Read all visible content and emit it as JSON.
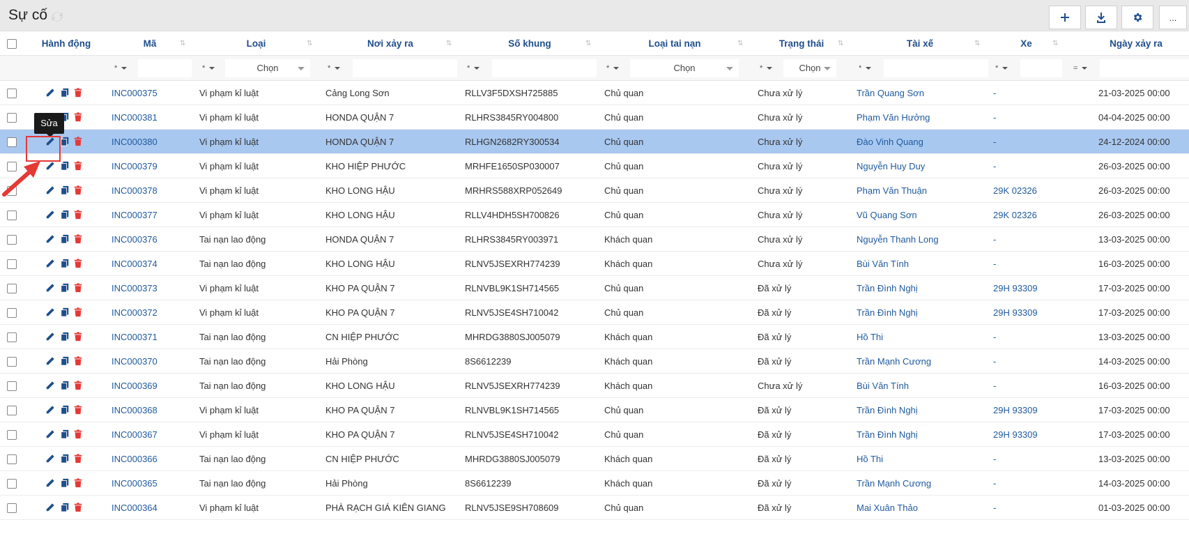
{
  "header": {
    "title": "Sự cố"
  },
  "toolbar": {
    "more_label": "..."
  },
  "columns": {
    "action": "Hành động",
    "code": "Mã",
    "type": "Loại",
    "place": "Nơi xảy ra",
    "chassis": "Số khung",
    "accident_type": "Loại tai nạn",
    "status": "Trạng thái",
    "driver": "Tài xế",
    "vehicle": "Xe",
    "date": "Ngày xảy ra"
  },
  "filters": {
    "op_star": "*",
    "op_eq": "=",
    "select_placeholder": "Chọn"
  },
  "tooltip": {
    "text": "Sửa"
  },
  "rows": [
    {
      "code": "INC000375",
      "type": "Vi phạm kỉ luật",
      "place": "Cảng Long Sơn",
      "chassis": "RLLV3F5DXSH725885",
      "accident_type": "Chủ quan",
      "status": "Chưa xử lý",
      "driver": "Trần Quang Sơn",
      "vehicle": "-",
      "date": "21-03-2025 00:00"
    },
    {
      "code": "INC000381",
      "type": "Vi phạm kỉ luật",
      "place": "HONDA QUẬN 7",
      "chassis": "RLHRS3845RY004800",
      "accident_type": "Chủ quan",
      "status": "Chưa xử lý",
      "driver": "Phạm Văn Hưởng",
      "vehicle": "-",
      "date": "04-04-2025 00:00"
    },
    {
      "code": "INC000380",
      "type": "Vi phạm kỉ luật",
      "place": "HONDA QUẬN 7",
      "chassis": "RLHGN2682RY300534",
      "accident_type": "Chủ quan",
      "status": "Chưa xử lý",
      "driver": "Đào Vinh Quang",
      "vehicle": "-",
      "date": "24-12-2024 00:00"
    },
    {
      "code": "INC000379",
      "type": "Vi phạm kỉ luật",
      "place": "KHO HIỆP PHƯỚC",
      "chassis": "MRHFE1650SP030007",
      "accident_type": "Chủ quan",
      "status": "Chưa xử lý",
      "driver": "Nguyễn Huy Duy",
      "vehicle": "-",
      "date": "26-03-2025 00:00"
    },
    {
      "code": "INC000378",
      "type": "Vi phạm kỉ luật",
      "place": "KHO LONG HẬU",
      "chassis": "MRHRS588XRP052649",
      "accident_type": "Chủ quan",
      "status": "Chưa xử lý",
      "driver": "Phạm Văn Thuận",
      "vehicle": "29K 02326",
      "date": "26-03-2025 00:00"
    },
    {
      "code": "INC000377",
      "type": "Vi phạm kỉ luật",
      "place": "KHO LONG HẬU",
      "chassis": "RLLV4HDH5SH700826",
      "accident_type": "Chủ quan",
      "status": "Chưa xử lý",
      "driver": "Vũ Quang Sơn",
      "vehicle": "29K 02326",
      "date": "26-03-2025 00:00"
    },
    {
      "code": "INC000376",
      "type": "Tai nạn lao động",
      "place": "HONDA QUẬN 7",
      "chassis": "RLHRS3845RY003971",
      "accident_type": "Khách quan",
      "status": "Chưa xử lý",
      "driver": "Nguyễn Thanh Long",
      "vehicle": "-",
      "date": "13-03-2025 00:00"
    },
    {
      "code": "INC000374",
      "type": "Tai nạn lao động",
      "place": "KHO LONG HẬU",
      "chassis": "RLNV5JSEXRH774239",
      "accident_type": "Khách quan",
      "status": "Chưa xử lý",
      "driver": "Bùi Văn Tính",
      "vehicle": "-",
      "date": "16-03-2025 00:00"
    },
    {
      "code": "INC000373",
      "type": "Vi phạm kỉ luật",
      "place": "KHO PA QUẬN 7",
      "chassis": "RLNVBL9K1SH714565",
      "accident_type": "Chủ quan",
      "status": "Đã xử lý",
      "driver": "Trần Đình Nghị",
      "vehicle": "29H 93309",
      "date": "17-03-2025 00:00"
    },
    {
      "code": "INC000372",
      "type": "Vi phạm kỉ luật",
      "place": "KHO PA QUẬN 7",
      "chassis": "RLNV5JSE4SH710042",
      "accident_type": "Chủ quan",
      "status": "Đã xử lý",
      "driver": "Trần Đình Nghị",
      "vehicle": "29H 93309",
      "date": "17-03-2025 00:00"
    },
    {
      "code": "INC000371",
      "type": "Tai nạn lao động",
      "place": "CN HIỆP PHƯỚC",
      "chassis": "MHRDG3880SJ005079",
      "accident_type": "Khách quan",
      "status": "Đã xử lý",
      "driver": "Hồ Thi",
      "vehicle": "-",
      "date": "13-03-2025 00:00"
    },
    {
      "code": "INC000370",
      "type": "Tai nạn lao động",
      "place": "Hải Phòng",
      "chassis": "8S6612239",
      "accident_type": "Khách quan",
      "status": "Đã xử lý",
      "driver": "Trần Mạnh Cương",
      "vehicle": "-",
      "date": "14-03-2025 00:00"
    },
    {
      "code": "INC000369",
      "type": "Tai nạn lao động",
      "place": "KHO LONG HẬU",
      "chassis": "RLNV5JSEXRH774239",
      "accident_type": "Khách quan",
      "status": "Chưa xử lý",
      "driver": "Bùi Văn Tính",
      "vehicle": "-",
      "date": "16-03-2025 00:00"
    },
    {
      "code": "INC000368",
      "type": "Vi phạm kỉ luật",
      "place": "KHO PA QUẬN 7",
      "chassis": "RLNVBL9K1SH714565",
      "accident_type": "Chủ quan",
      "status": "Đã xử lý",
      "driver": "Trần Đình Nghị",
      "vehicle": "29H 93309",
      "date": "17-03-2025 00:00"
    },
    {
      "code": "INC000367",
      "type": "Vi phạm kỉ luật",
      "place": "KHO PA QUẬN 7",
      "chassis": "RLNV5JSE4SH710042",
      "accident_type": "Chủ quan",
      "status": "Đã xử lý",
      "driver": "Trần Đình Nghị",
      "vehicle": "29H 93309",
      "date": "17-03-2025 00:00"
    },
    {
      "code": "INC000366",
      "type": "Tai nạn lao động",
      "place": "CN HIỆP PHƯỚC",
      "chassis": "MHRDG3880SJ005079",
      "accident_type": "Khách quan",
      "status": "Đã xử lý",
      "driver": "Hồ Thi",
      "vehicle": "-",
      "date": "13-03-2025 00:00"
    },
    {
      "code": "INC000365",
      "type": "Tai nạn lao động",
      "place": "Hải Phòng",
      "chassis": "8S6612239",
      "accident_type": "Khách quan",
      "status": "Đã xử lý",
      "driver": "Trần Mạnh Cương",
      "vehicle": "-",
      "date": "14-03-2025 00:00"
    },
    {
      "code": "INC000364",
      "type": "Vi phạm kỉ luật",
      "place": "PHÀ RẠCH GIÁ KIÊN GIANG",
      "chassis": "RLNV5JSE9SH708609",
      "accident_type": "Chủ quan",
      "status": "Đã xử lý",
      "driver": "Mai Xuân Thảo",
      "vehicle": "-",
      "date": "01-03-2025 00:00"
    }
  ],
  "colors": {
    "link": "#1f5a9e",
    "header": "#1f4e8c",
    "selected_row": "#a9c8f0",
    "delete": "#e53935",
    "highlight": "#e53935"
  }
}
